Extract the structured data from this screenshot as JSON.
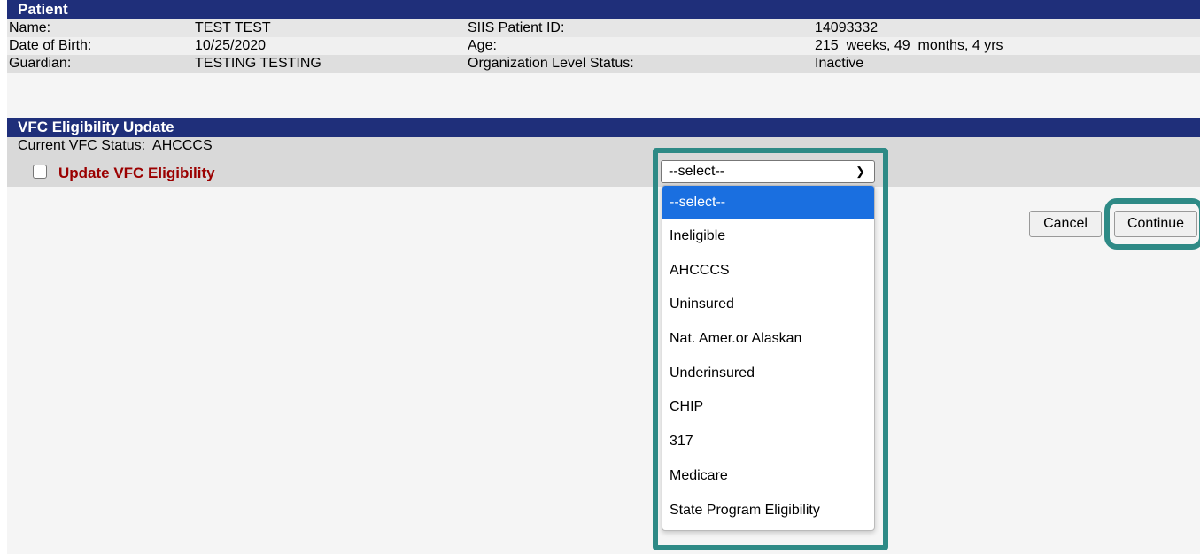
{
  "patient": {
    "header": "Patient",
    "rows": [
      {
        "label1": "Name:",
        "value1": "TEST TEST",
        "label2": "SIIS Patient ID:",
        "value2": "14093332"
      },
      {
        "label1": "Date of Birth:",
        "value1": "10/25/2020",
        "label2": "Age:",
        "value2": "215  weeks, 49  months, 4 yrs"
      },
      {
        "label1": "Guardian:",
        "value1": "TESTING TESTING",
        "label2": "Organization Level Status:",
        "value2": "Inactive"
      }
    ]
  },
  "vfc": {
    "header": "VFC Eligibility Update",
    "current_status": "Current VFC Status:  AHCCCS",
    "update_label": "Update VFC Eligibility",
    "select": {
      "selected": "--select--",
      "options": [
        "--select--",
        "Ineligible",
        "AHCCCS",
        "Uninsured",
        "Nat. Amer.or Alaskan",
        "Underinsured",
        "CHIP",
        "317",
        "Medicare",
        "State Program Eligibility"
      ]
    }
  },
  "buttons": {
    "cancel": "Cancel",
    "continue": "Continue"
  },
  "colors": {
    "header_bg": "#1f2f7a",
    "accent_highlight": "#2e8a86",
    "selected_option": "#1a6fe0",
    "update_label": "#9b0000"
  }
}
